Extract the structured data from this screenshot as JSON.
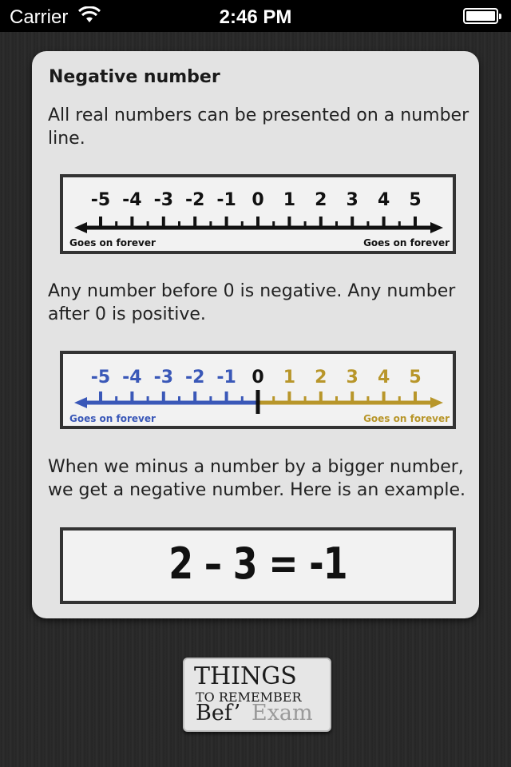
{
  "status_bar": {
    "carrier": "Carrier",
    "time": "2:46 PM"
  },
  "card": {
    "title": "Negative number",
    "paragraph1": "All real numbers can be presented on a number line.",
    "paragraph2": "Any number before 0 is negative. Any number after 0 is positive.",
    "paragraph3": "When we minus a number by a bigger number, we get a negative number. Here is an example.",
    "equation": "2 – 3 = -1"
  },
  "number_line": {
    "ticks": [
      "-5",
      "-4",
      "-3",
      "-2",
      "-1",
      "0",
      "1",
      "2",
      "3",
      "4",
      "5"
    ],
    "left_caption": "Goes on forever",
    "right_caption": "Goes on forever",
    "colors": {
      "plain": "#111111",
      "negative": "#3a58b8",
      "positive": "#b8962a",
      "zero": "#111111"
    }
  },
  "logo": {
    "line1": "THINGS",
    "line2": "TO REMEMBER",
    "line3": "Bef’",
    "line4": "Exam"
  }
}
